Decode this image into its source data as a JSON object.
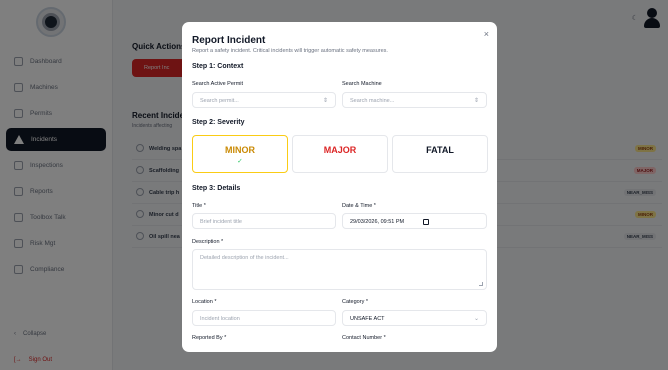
{
  "sidebar": {
    "items": [
      {
        "label": "Dashboard",
        "icon": "grid-icon"
      },
      {
        "label": "Machines",
        "icon": "wrench-icon"
      },
      {
        "label": "Permits",
        "icon": "file-icon"
      },
      {
        "label": "Incidents",
        "icon": "warning-icon"
      },
      {
        "label": "Inspections",
        "icon": "clipboard-icon"
      },
      {
        "label": "Reports",
        "icon": "chart-icon"
      },
      {
        "label": "Toolbox Talk",
        "icon": "megaphone-icon"
      },
      {
        "label": "Risk Mgt",
        "icon": "shield-icon"
      },
      {
        "label": "Compliance",
        "icon": "check-icon"
      }
    ],
    "active_index": 3,
    "collapse_label": "Collapse",
    "signout_label": "Sign Out"
  },
  "main": {
    "quick_actions_title": "Quick Actions",
    "report_button": "Report Inc",
    "recent_title": "Recent Incidents",
    "recent_sub": "Incidents affecting",
    "rows": [
      {
        "text": "Welding spa",
        "badge": "MINOR"
      },
      {
        "text": "Scaffolding",
        "badge": "MAJOR"
      },
      {
        "text": "Cable trip h",
        "badge": "NEAR_MISS"
      },
      {
        "text": "Minor cut d",
        "badge": "MINOR"
      },
      {
        "text": "Oil spill nea",
        "badge": "NEAR_MISS"
      }
    ]
  },
  "modal": {
    "title": "Report Incident",
    "subtitle": "Report a safety incident. Critical incidents will trigger automatic safety measures.",
    "close_glyph": "×",
    "step1": "Step 1: Context",
    "permit_label": "Search Active Permit",
    "permit_placeholder": "Search permit...",
    "machine_label": "Search Machine",
    "machine_placeholder": "Search machine...",
    "step2": "Step 2: Severity",
    "severity": [
      {
        "label": "MINOR",
        "color": "#ca8a04",
        "selected": true
      },
      {
        "label": "MAJOR",
        "color": "#dc2626",
        "selected": false
      },
      {
        "label": "FATAL",
        "color": "#111827",
        "selected": false
      }
    ],
    "check_glyph": "✓",
    "step3": "Step 3: Details",
    "title_label": "Title *",
    "title_placeholder": "Brief incident title",
    "datetime_label": "Date & Time *",
    "datetime_value": "29/03/2026, 09:51 PM",
    "description_label": "Description *",
    "description_placeholder": "Detailed description of the incident...",
    "location_label": "Location *",
    "location_placeholder": "Incident location",
    "category_label": "Category *",
    "category_value": "UNSAFE ACT",
    "reported_by_label": "Reported By *",
    "contact_label": "Contact Number *"
  },
  "colors": {
    "accent": "#dc2626",
    "minor": "#ca8a04",
    "active_nav": "#111827"
  }
}
